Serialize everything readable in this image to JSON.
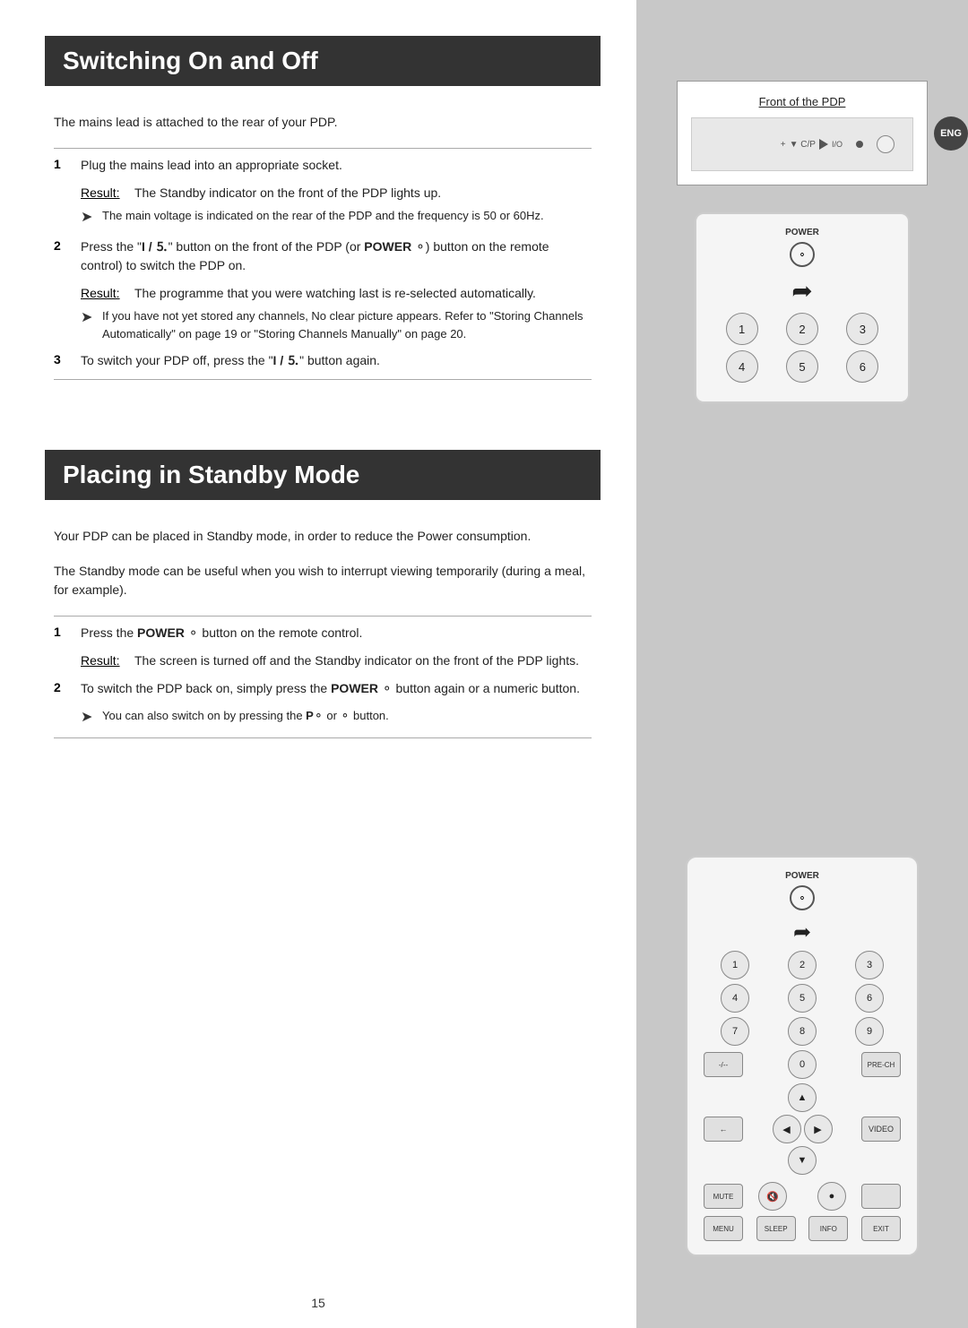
{
  "sections": {
    "section1": {
      "title": "Switching On and Off",
      "intro": "The mains lead is attached to the rear of your PDP.",
      "steps": [
        {
          "num": "1",
          "text": "Plug the mains lead into an appropriate socket.",
          "result_label": "Result:",
          "result": "The Standby indicator on the front of the PDP lights up.",
          "notes": [
            "The main voltage is indicated on the rear of the PDP and the frequency is 50 or 60Hz."
          ]
        },
        {
          "num": "2",
          "text": "Press the \" I / \" button on the front of the PDP (or POWER button on the remote control) to switch the PDP on.",
          "result_label": "Result:",
          "result": "The programme that you were watching last is re-selected automatically.",
          "notes": [
            "If you have not yet stored any channels, No clear picture appears. Refer to \"Storing Channels Automatically\" on page 19 or \"Storing Channels Manually\" on page 20."
          ]
        },
        {
          "num": "3",
          "text": "To switch your PDP off, press the \" I / \" button again."
        }
      ]
    },
    "section2": {
      "title": "Placing in Standby Mode",
      "intro1": "Your PDP can be placed in Standby mode, in order to reduce the Power consumption.",
      "intro2": "The Standby mode can be useful when you wish to interrupt viewing temporarily (during a meal, for example).",
      "steps": [
        {
          "num": "1",
          "text": "Press the POWER button on the remote control.",
          "result_label": "Result:",
          "result": "The screen is turned off and the Standby indicator on the front of the PDP lights."
        },
        {
          "num": "2",
          "text": "To switch the PDP back on, simply press the POWER button again or a numeric button.",
          "notes": [
            "You can also switch on by pressing the P or button."
          ]
        }
      ]
    }
  },
  "diagrams": {
    "front_pdp_label": "Front of the PDP",
    "remote_power_label": "POWER",
    "btn_labels_1": [
      "1",
      "2",
      "3",
      "4",
      "5",
      "6"
    ],
    "btn_labels_2": [
      "1",
      "2",
      "3",
      "4",
      "5",
      "6",
      "7",
      "8",
      "9",
      "",
      "0",
      ""
    ],
    "eng_badge": "ENG"
  },
  "page_number": "15"
}
